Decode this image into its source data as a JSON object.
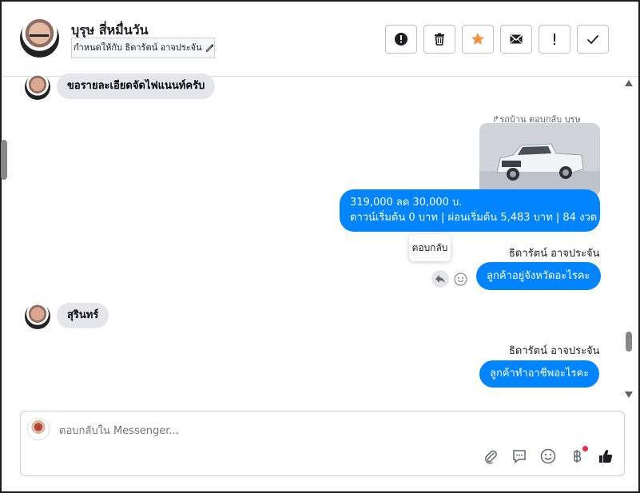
{
  "header": {
    "name": "บุรุษ สี่หมื่นวัน",
    "assigned_to": "กำหนดให้กับ ธิดารัตน์ อาจประจัน",
    "toolbar": [
      "spam-icon",
      "trash-icon",
      "star-icon",
      "envelope-icon",
      "exclamation-icon",
      "check-icon"
    ],
    "star_color": "#f7923a"
  },
  "messages": {
    "in1": "ขอรายละเอียดจัดไฟแนนท์ครับ",
    "reply_context": "รถบ้าน ตอบกลับ บุรุษ",
    "price_line1": "319,000 ลด 30,000 บ.",
    "price_line2": "ดาวน์เริ่มต้น 0 บาท | ผ่อนเริ่มต้น 5,483 บาท | 84 งวด",
    "sender1": "ธิดารัตน์ อาจประจัน",
    "tooltip": "ตอบกลับ",
    "out2": "ลูกค้าอยู่จังหวัดอะไรคะ",
    "in2": "สุรินทร์",
    "sender2": "ธิดารัตน์ อาจประจัน",
    "out3": "ลูกค้าทำอาชีพอะไรคะ",
    "bubble_color": "#0084ff"
  },
  "composer": {
    "placeholder": "ตอบกลับใน Messenger..."
  }
}
